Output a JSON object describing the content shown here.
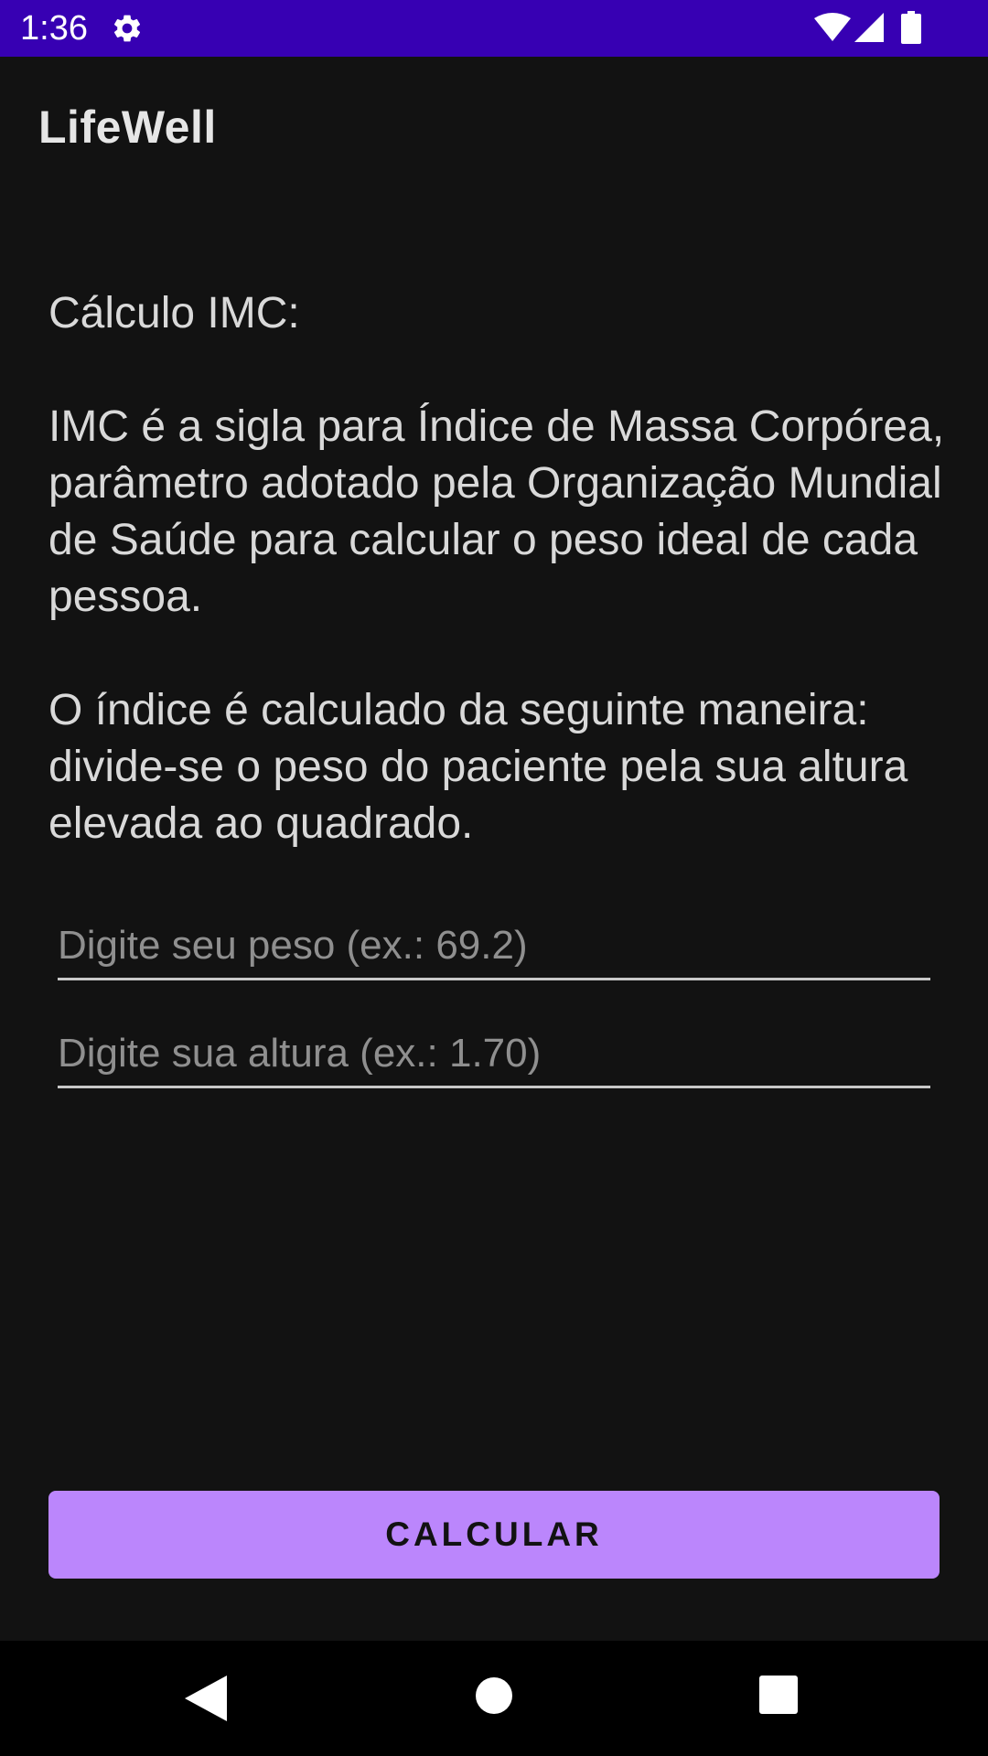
{
  "status_bar": {
    "time": "1:36",
    "icons": [
      "gear-icon",
      "wifi-icon",
      "signal-icon",
      "battery-icon"
    ],
    "background_color": "#3700B3"
  },
  "app_bar": {
    "title": "LifeWell"
  },
  "content": {
    "heading": "Cálculo IMC:",
    "paragraph_1": "IMC é a sigla para Índice de Massa Corpórea, parâmetro adotado pela Organização Mundial de Saúde para calcular o peso ideal de cada pessoa.",
    "paragraph_2": "O índice é calculado da seguinte maneira: divide-se o peso do paciente pela sua altura elevada ao quadrado."
  },
  "form": {
    "weight": {
      "placeholder": "Digite seu peso (ex.: 69.2)",
      "value": ""
    },
    "height": {
      "placeholder": "Digite sua altura (ex.: 1.70)",
      "value": ""
    },
    "submit_label": "CALCULAR"
  },
  "nav_bar": {
    "icons": [
      "back-icon",
      "home-icon",
      "recents-icon"
    ]
  },
  "colors": {
    "background": "#121212",
    "accent": "#BB86FC",
    "status_bar": "#3700B3"
  }
}
